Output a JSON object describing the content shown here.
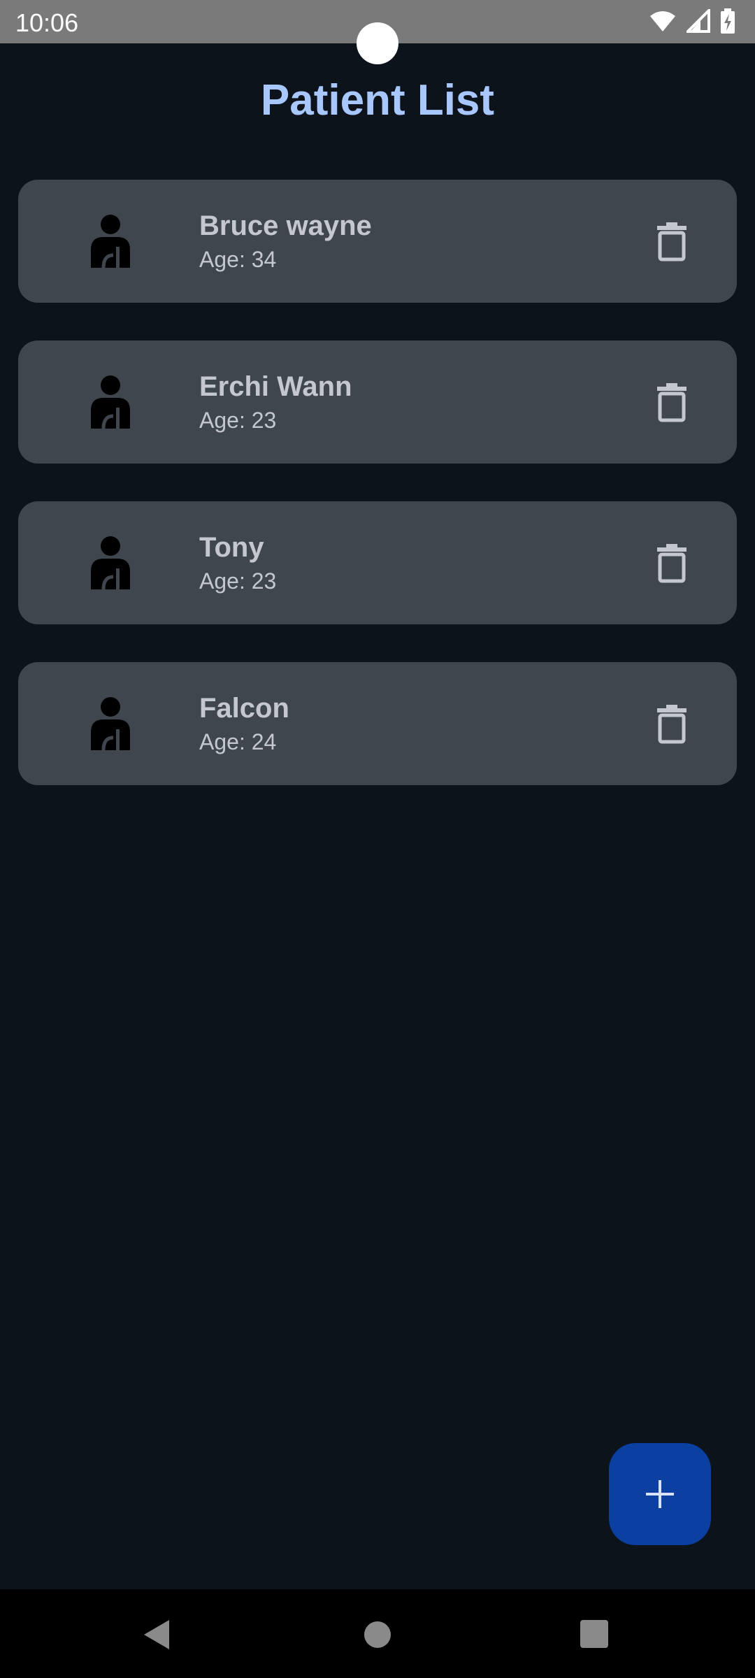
{
  "status_bar": {
    "time": "10:06"
  },
  "header": {
    "title": "Patient List"
  },
  "patients": [
    {
      "name": "Bruce wayne",
      "age": "Age: 34"
    },
    {
      "name": "Erchi Wann",
      "age": "Age: 23"
    },
    {
      "name": "Tony",
      "age": "Age: 23"
    },
    {
      "name": "Falcon",
      "age": "Age: 24"
    }
  ],
  "icons": {
    "avatar": "person-icon",
    "delete": "trash-icon",
    "fab": "plus-icon",
    "wifi": "wifi-icon",
    "signal": "signal-icon",
    "battery": "battery-icon"
  },
  "colors": {
    "background": "#0d131a",
    "card": "#40464e",
    "title": "#a9c7ff",
    "fab": "#0b3fa0"
  }
}
